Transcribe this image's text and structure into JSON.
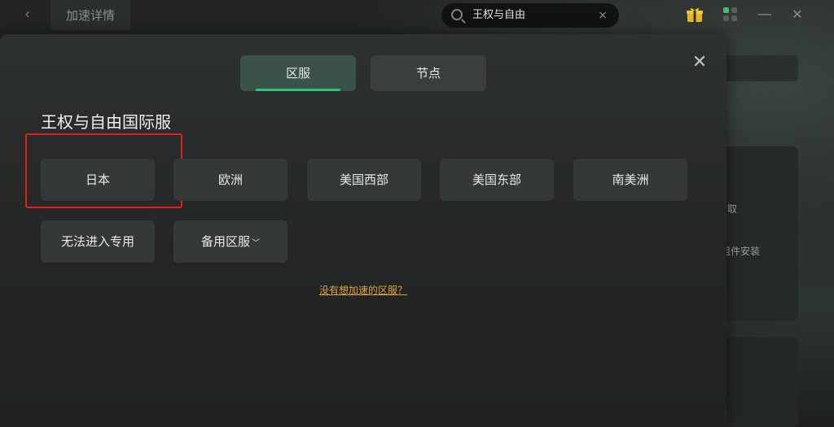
{
  "topbar": {
    "tab_title": "加速详情",
    "search_value": "王权与自由",
    "search_clear": "×",
    "back_icon": "chevron-left-icon",
    "minimize_symbol": "—",
    "close_symbol": "✕"
  },
  "background": {
    "side_text_1": "取",
    "side_text_2": "组件安装"
  },
  "modal": {
    "close_symbol": "✕",
    "tabs": [
      {
        "label": "区服",
        "active": true
      },
      {
        "label": "节点",
        "active": false
      }
    ],
    "game_title": "王权与自由国际服",
    "servers": [
      {
        "label": "日本",
        "selected": true
      },
      {
        "label": "欧洲"
      },
      {
        "label": "美国西部"
      },
      {
        "label": "美国东部"
      },
      {
        "label": "南美洲"
      },
      {
        "label": "无法进入专用"
      },
      {
        "label": "备用区服"
      }
    ],
    "dropdown_caret": "﹀",
    "help_link": "没有想加速的区服？"
  },
  "colors": {
    "accent_green": "#31c47a",
    "highlight_red": "#e21f1f",
    "link_orange": "#e0a13c"
  }
}
